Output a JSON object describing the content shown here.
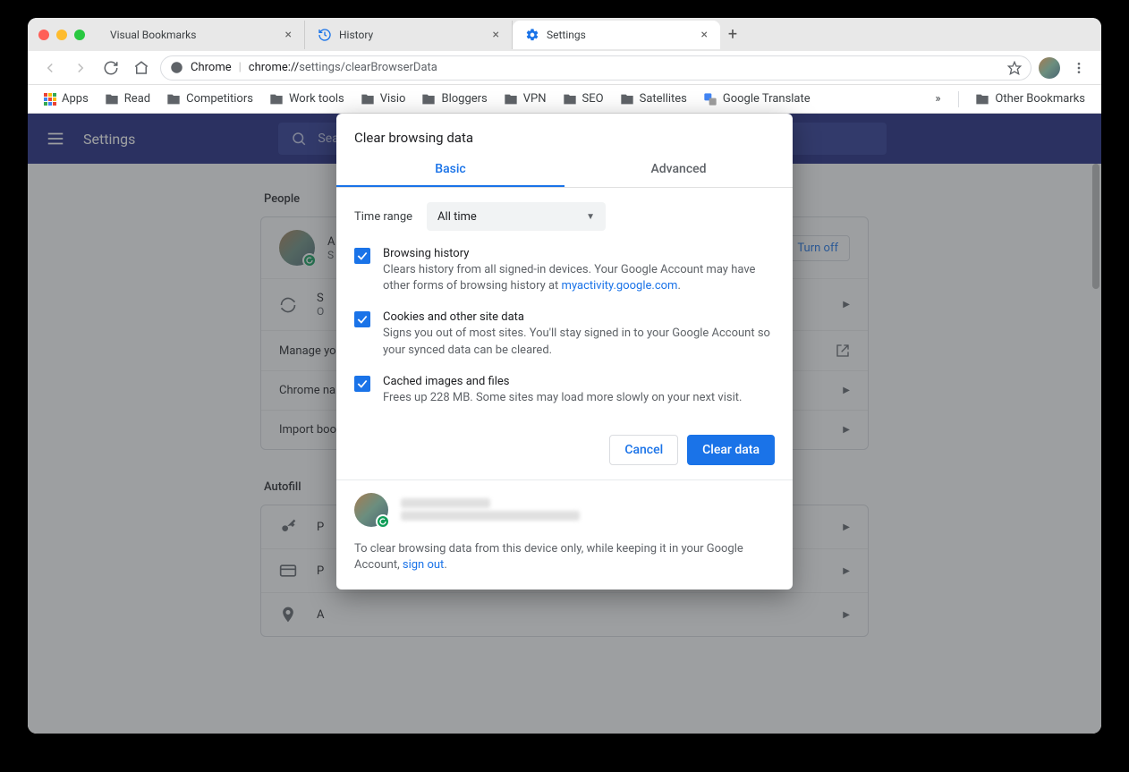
{
  "tabs": [
    {
      "label": "Visual Bookmarks"
    },
    {
      "label": "History"
    },
    {
      "label": "Settings"
    }
  ],
  "omnibox": {
    "scheme_label": "Chrome",
    "url_host": "chrome://",
    "url_path": "settings/clearBrowserData"
  },
  "bookmarks": {
    "apps": "Apps",
    "items": [
      "Read",
      "Competitiors",
      "Work tools",
      "Visio",
      "Bloggers",
      "VPN",
      "SEO",
      "Satellites"
    ],
    "translate": "Google Translate",
    "more_glyph": "»",
    "other": "Other Bookmarks"
  },
  "settings_app": {
    "title": "Settings",
    "search_placeholder": "Search settings"
  },
  "sections": {
    "people": {
      "title": "People",
      "account_name": "A",
      "account_sub": "S",
      "turn_off": "Turn off",
      "sync_row_label": "S",
      "sync_row_sub": "O",
      "manage_row": "Manage yo",
      "chrome_name_row": "Chrome na",
      "import_row": "Import boo"
    },
    "autofill": {
      "title": "Autofill",
      "passwords_row": "P",
      "payment_row": "P",
      "addresses_row": "A"
    }
  },
  "dialog": {
    "title": "Clear browsing data",
    "tab_basic": "Basic",
    "tab_advanced": "Advanced",
    "time_range_label": "Time range",
    "time_range_value": "All time",
    "options": [
      {
        "title": "Browsing history",
        "desc_pre": "Clears history from all signed-in devices. Your Google Account may have other forms of browsing history at ",
        "desc_link": "myactivity.google.com",
        "desc_post": "."
      },
      {
        "title": "Cookies and other site data",
        "desc": "Signs you out of most sites. You'll stay signed in to your Google Account so your synced data can be cleared."
      },
      {
        "title": "Cached images and files",
        "desc": "Frees up 228 MB. Some sites may load more slowly on your next visit."
      }
    ],
    "cancel": "Cancel",
    "clear": "Clear data",
    "footer_msg_pre": "To clear browsing data from this device only, while keeping it in your Google Account, ",
    "footer_link": "sign out",
    "footer_msg_post": "."
  }
}
